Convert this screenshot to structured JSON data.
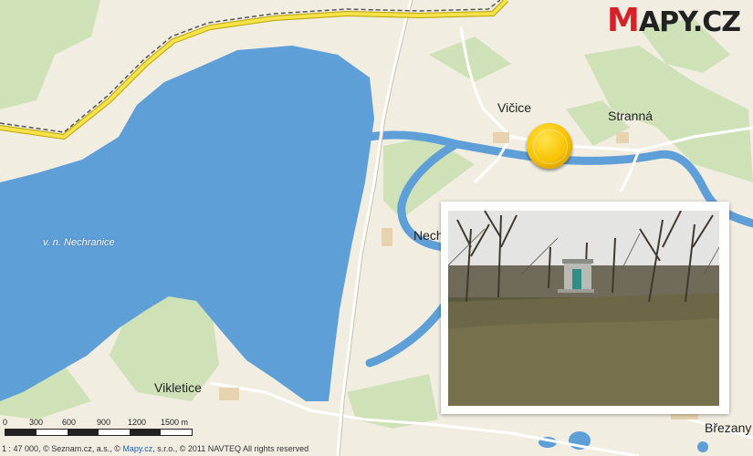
{
  "logo": {
    "first_letter": "M",
    "rest": "APY.CZ"
  },
  "places": {
    "vicice": "Vičice",
    "stranna": "Stranná",
    "nechranice_partial": "Nech",
    "vikletice": "Vikletice",
    "brezany_partial": "Březany"
  },
  "water": {
    "reservoir_label": "v. n. Nechranice"
  },
  "scale_bar": {
    "ticks": [
      "0",
      "300",
      "600",
      "900",
      "1200",
      "1500 m"
    ]
  },
  "footer": {
    "scale_text": "1 : 47 000,",
    "credit_before_link": "© Seznam.cz, a.s., ©",
    "link_text": "Mapy.cz",
    "credit_after_link": ", s.r.o., © 2011 NAVTEQ All rights reserved"
  },
  "colors": {
    "land": "#f1ede1",
    "water": "#5f9fd8",
    "forest": "#cfe2b7",
    "main_road": "#f6e24a",
    "pin": "#f7c200",
    "logo_red": "#d62128"
  },
  "photo": {
    "subject": "small green-door pump house by the river among bare trees"
  }
}
